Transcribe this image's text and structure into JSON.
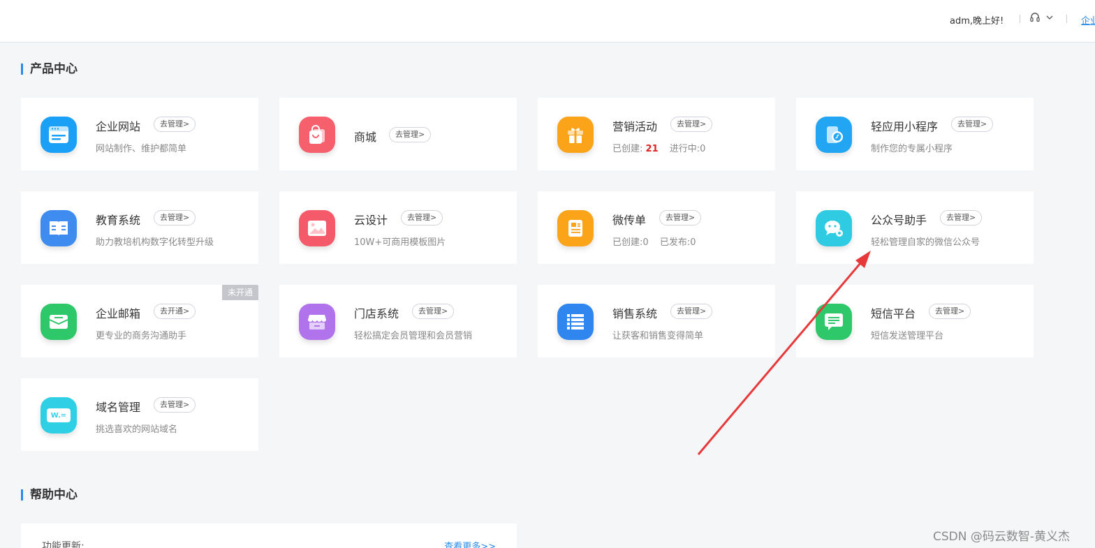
{
  "header": {
    "greeting": "adm,晚上好!",
    "enterprise_link": "企业"
  },
  "product_center": {
    "title": "产品中心",
    "cards": [
      {
        "name": "企业网站",
        "action": "去管理>",
        "desc": "网站制作、维护都简单",
        "icon": "website-icon",
        "color": "#1aa0f6"
      },
      {
        "name": "商城",
        "action": "去管理>",
        "icon": "shopping-bag-icon",
        "color": "#f5606c"
      },
      {
        "name": "营销活动",
        "action": "去管理>",
        "stat1_label": "已创建:",
        "stat1_value": "21",
        "stat2_label": "进行中:",
        "stat2_value": "0",
        "icon": "gift-icon",
        "color": "#fba319"
      },
      {
        "name": "轻应用小程序",
        "action": "去管理>",
        "desc": "制作您的专属小程序",
        "icon": "mini-program-icon",
        "color": "#22a6f3"
      },
      {
        "name": "教育系统",
        "action": "去管理>",
        "desc": "助力教培机构数字化转型升级",
        "icon": "book-icon",
        "color": "#3e8cf0"
      },
      {
        "name": "云设计",
        "action": "去管理>",
        "desc": "10W+可商用模板图片",
        "icon": "image-icon",
        "color": "#f55a6a"
      },
      {
        "name": "微传单",
        "action": "去管理>",
        "stat1_label": "已创建:",
        "stat1_value": "0",
        "stat2_label": "已发布:",
        "stat2_value": "0",
        "icon": "flyer-icon",
        "color": "#fba319"
      },
      {
        "name": "公众号助手",
        "action": "去管理>",
        "desc": "轻松管理自家的微信公众号",
        "icon": "wechat-icon",
        "color": "#2ecbe3"
      },
      {
        "name": "企业邮箱",
        "action": "去开通>",
        "desc": "更专业的商务沟通助手",
        "ribbon": "未开通",
        "icon": "mail-icon",
        "color": "#2ec76a"
      },
      {
        "name": "门店系统",
        "action": "去管理>",
        "desc": "轻松搞定会员管理和会员营销",
        "icon": "store-icon",
        "color": "#b073ec"
      },
      {
        "name": "销售系统",
        "action": "去管理>",
        "desc": "让获客和销售变得简单",
        "icon": "list-icon",
        "color": "#2f86ee"
      },
      {
        "name": "短信平台",
        "action": "去管理>",
        "desc": "短信发送管理平台",
        "icon": "sms-icon",
        "color": "#2ec76a"
      },
      {
        "name": "域名管理",
        "action": "去管理>",
        "desc": "挑选喜欢的网站域名",
        "icon": "domain-icon",
        "color": "#2fd0e6",
        "icon_text": "W.="
      }
    ]
  },
  "help_center": {
    "title": "帮助中心",
    "update_label": "功能更新:",
    "more_link": "查看更多>>"
  },
  "watermark": "CSDN @码云数智-黄义杰",
  "annotation_color": "#e8393a"
}
